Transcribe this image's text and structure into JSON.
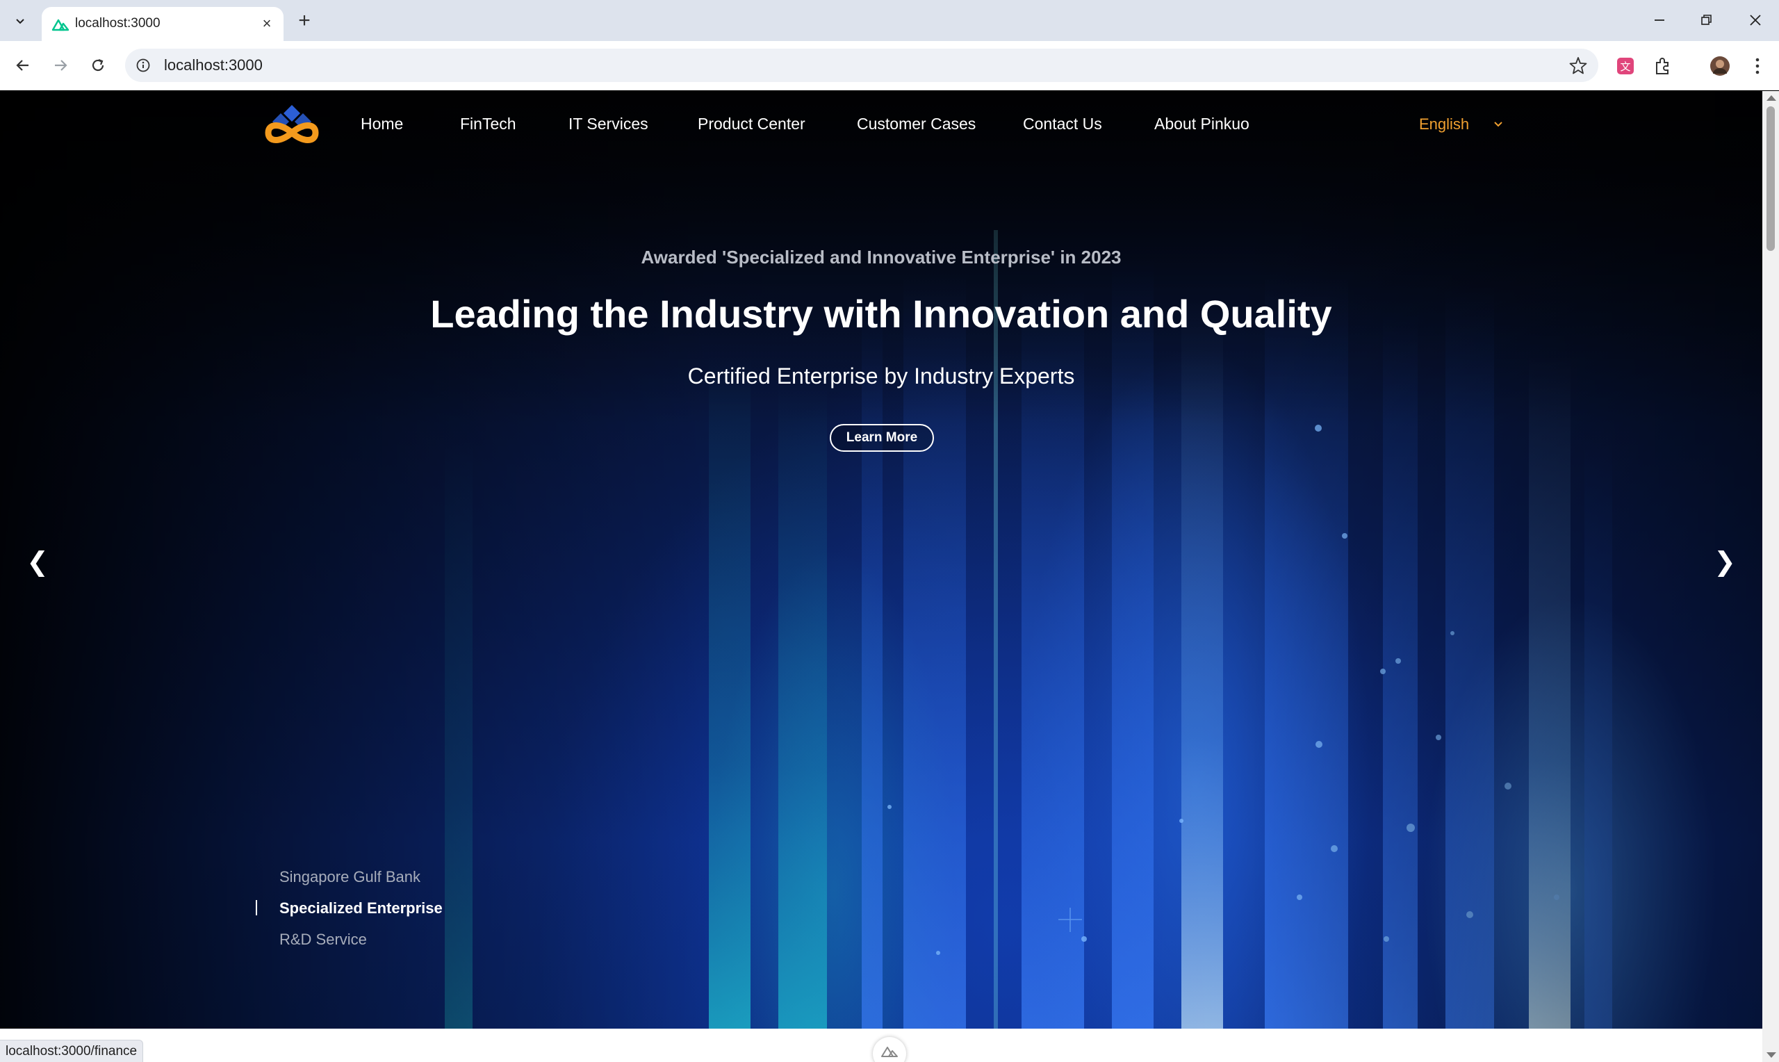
{
  "browser": {
    "tab_title": "localhost:3000",
    "url": "localhost:3000",
    "status_url": "localhost:3000/finance"
  },
  "site": {
    "nav": [
      {
        "label": "Home"
      },
      {
        "label": "FinTech"
      },
      {
        "label": "IT Services"
      },
      {
        "label": "Product Center"
      },
      {
        "label": "Customer Cases"
      },
      {
        "label": "Contact Us"
      },
      {
        "label": "About Pinkuo"
      }
    ],
    "language": "English"
  },
  "hero": {
    "eyebrow": "Awarded 'Specialized and Innovative Enterprise' in 2023",
    "title": "Leading the Industry with Innovation and Quality",
    "subtitle": "Certified Enterprise by Industry Experts",
    "cta_label": "Learn More",
    "prev_arrow": "❮",
    "next_arrow": "❯",
    "slides": [
      {
        "label": "Singapore Gulf Bank",
        "active": false
      },
      {
        "label": "Specialized Enterprise",
        "active": true
      },
      {
        "label": "R&D Service",
        "active": false
      }
    ]
  },
  "colors": {
    "accent_language": "#f0a030",
    "logo_orange": "#f39a1d",
    "logo_blue": "#2c5fd6"
  }
}
